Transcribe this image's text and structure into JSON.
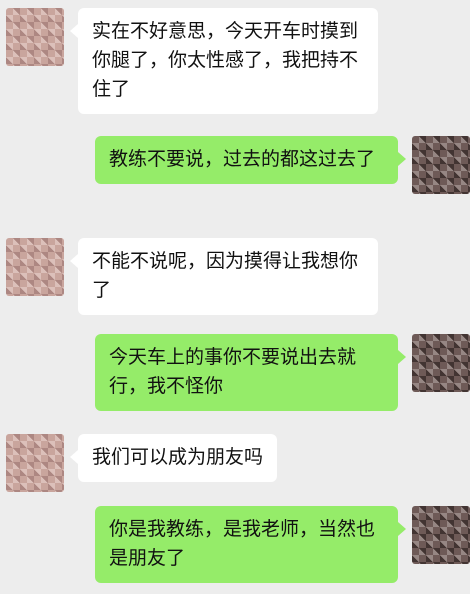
{
  "messages": [
    {
      "side": "left",
      "text": "实在不好意思，今天开车时摸到你腿了，你太性感了，我把持不住了"
    },
    {
      "side": "right",
      "text": "教练不要说，过去的都这过去了"
    },
    {
      "side": "left",
      "text": "不能不说呢，因为摸得让我想你了"
    },
    {
      "side": "right",
      "text": "今天车上的事你不要说出去就行，我不怪你"
    },
    {
      "side": "left",
      "text": "我们可以成为朋友吗"
    },
    {
      "side": "right",
      "text": "你是我教练，是我老师，当然也是朋友了"
    }
  ],
  "colors": {
    "background": "#ededed",
    "incoming_bubble": "#ffffff",
    "outgoing_bubble": "#95ec69"
  },
  "icons": {
    "contact_avatar": "avatar-icon",
    "self_avatar": "avatar-icon"
  }
}
